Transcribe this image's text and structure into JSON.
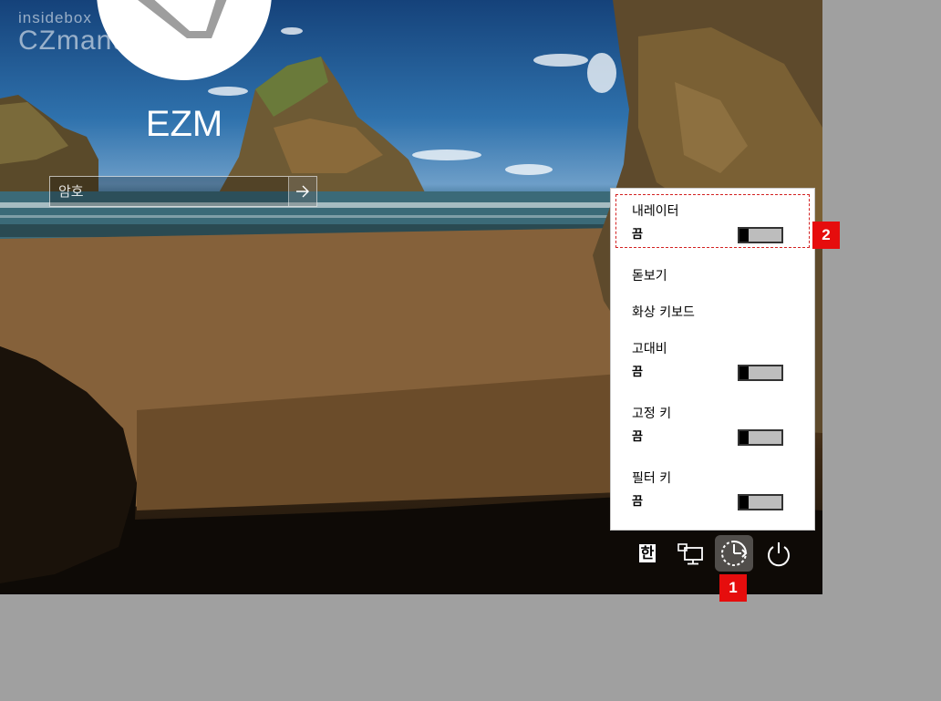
{
  "watermark": {
    "line1": "insidebox",
    "line2": "CZmanual"
  },
  "user": {
    "name": "EZM"
  },
  "password": {
    "placeholder": "암호",
    "value": ""
  },
  "ease_menu": {
    "items": [
      {
        "label": "내레이터",
        "status": "끔",
        "has_toggle": true,
        "on": false
      },
      {
        "label": "돋보기",
        "has_toggle": false
      },
      {
        "label": "화상 키보드",
        "has_toggle": false
      },
      {
        "label": "고대비",
        "status": "끔",
        "has_toggle": true,
        "on": false
      },
      {
        "label": "고정 키",
        "status": "끔",
        "has_toggle": true,
        "on": false
      },
      {
        "label": "필터 키",
        "status": "끔",
        "has_toggle": true,
        "on": false
      }
    ]
  },
  "tray": {
    "ime_label": "한",
    "icons": [
      "input-language-icon",
      "network-icon",
      "ease-of-access-icon",
      "power-icon"
    ]
  },
  "callouts": {
    "one": "1",
    "two": "2"
  },
  "colors": {
    "callout": "#e60d0d",
    "panel_bg": "#ffffff",
    "toggle_off": "#bdbdbd"
  }
}
